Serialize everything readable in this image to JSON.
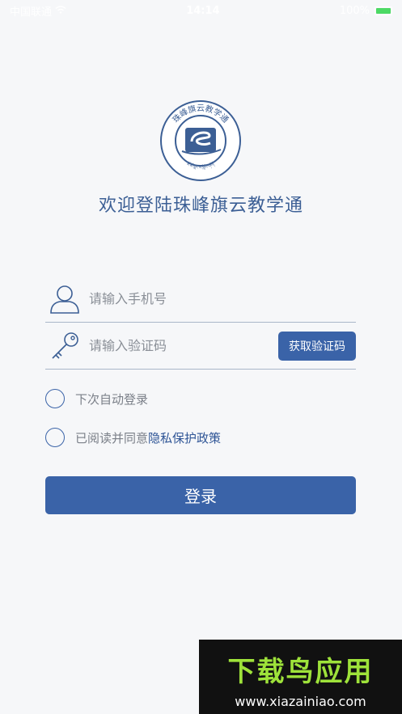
{
  "status_bar": {
    "carrier": "中国联通",
    "time": "14:14",
    "battery_text": "100%"
  },
  "app": {
    "logo_text": "珠峰旗云教学通",
    "logo_subtext": "ཇོ་མོ་གླང་མ་སློབ་གསོ།",
    "welcome": "欢迎登陆珠峰旗云教学通"
  },
  "form": {
    "phone_placeholder": "请输入手机号",
    "code_placeholder": "请输入验证码",
    "code_button": "获取验证码",
    "auto_login": "下次自动登录",
    "privacy_prefix": "已阅读并同意",
    "privacy_link": "隐私保护政策",
    "login_button": "登录"
  },
  "watermark": {
    "title": "下载鸟应用",
    "url": "www.xiazainiao.com"
  },
  "colors": {
    "accent": "#3a63a8",
    "text_title": "#3c5f95",
    "background": "#f6f7f9"
  }
}
